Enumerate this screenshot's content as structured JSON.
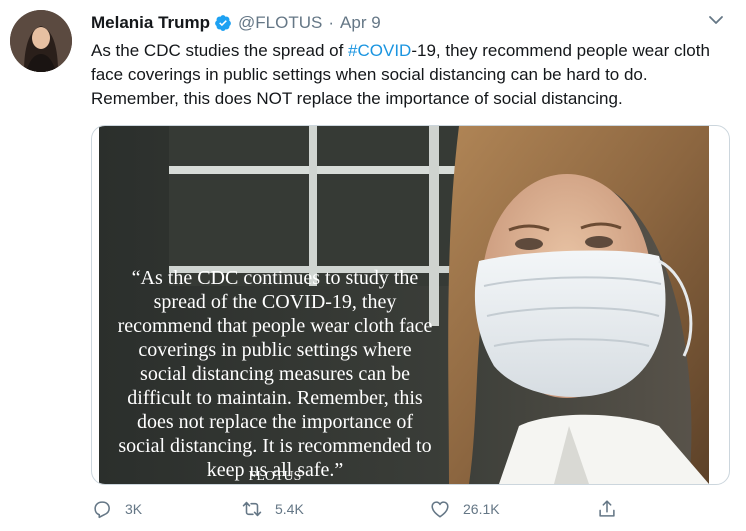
{
  "tweet": {
    "author_name": "Melania Trump",
    "verified_icon": "verified-badge-icon",
    "handle": "@FLOTUS",
    "separator": "·",
    "time": "Apr 9",
    "text_before": "As the CDC studies the spread of ",
    "hashtag": "#COVID",
    "text_after": "-19, they recommend people wear cloth face coverings in public settings when social distancing can be hard to do. Remember, this does NOT replace the importance of social distancing.",
    "media": {
      "quote_lines": [
        "“As the CDC continues to study the",
        "spread of the COVID-19, they",
        "recommend that people wear cloth face",
        "coverings in public settings where",
        "social distancing measures can be",
        "difficult to maintain. Remember, this",
        "does not replace the importance of",
        "social distancing. It is recommended to",
        "keep us all safe.”"
      ],
      "signature": "FLOTUS"
    },
    "actions": {
      "reply_count": "3K",
      "retweet_count": "5.4K",
      "like_count": "26.1K"
    }
  },
  "colors": {
    "accent": "#1b95e0",
    "verified": "#1da1f2",
    "secondary_text": "#657786",
    "primary_text": "#14171a"
  }
}
